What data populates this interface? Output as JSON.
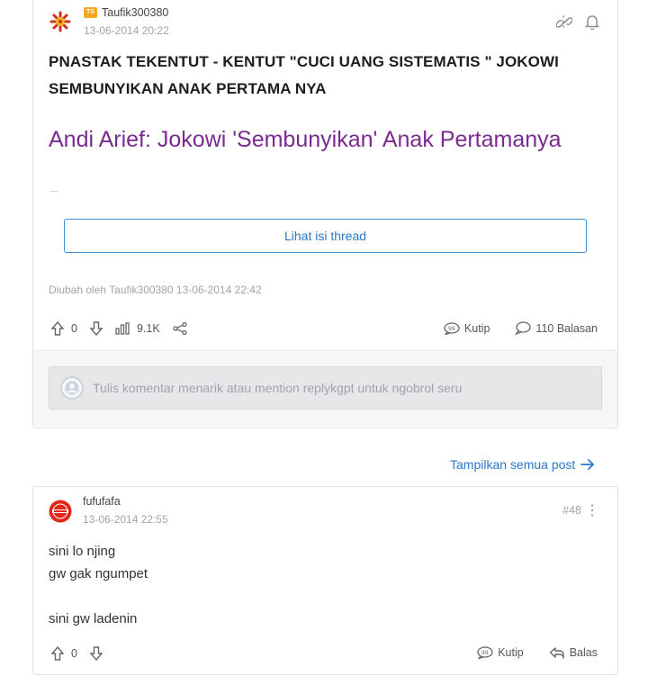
{
  "post1": {
    "author": "Taufik300380",
    "badge": "TS",
    "date": "13-06-2014 20:22",
    "title": "PNASTAK TEKENTUT - KENTUT \"CUCI UANG SISTEMATIS \" JOKOWI SEMBUNYIKAN ANAK PERTAMA NYA",
    "link_title": "Andi Arief: Jokowi 'Sembunyikan' Anak Pertamanya",
    "thread_button": "Lihat isi thread",
    "edited_note": "Diubah oleh Taufik300380 13-06-2014 22:42",
    "votes": "0",
    "views": "9.1K",
    "quote_label": "Kutip",
    "replies_label": "110 Balasan",
    "comment_placeholder": "Tulis komentar menarik atau mention replykgpt untuk ngobrol seru"
  },
  "show_all_label": "Tampilkan semua post",
  "post2": {
    "author": "fufufafa",
    "date": "13-06-2014 22:55",
    "post_number": "#48",
    "lines": [
      "sini lo njing",
      "gw gak ngumpet",
      "",
      "sini gw ladenin"
    ],
    "votes": "0",
    "quote_label": "Kutip",
    "reply_label": "Balas"
  },
  "colors": {
    "link_purple": "#7b2a8f",
    "accent_blue": "#2a78c8",
    "badge_orange": "#f5a623",
    "muted_gray": "#a0a4aa"
  }
}
